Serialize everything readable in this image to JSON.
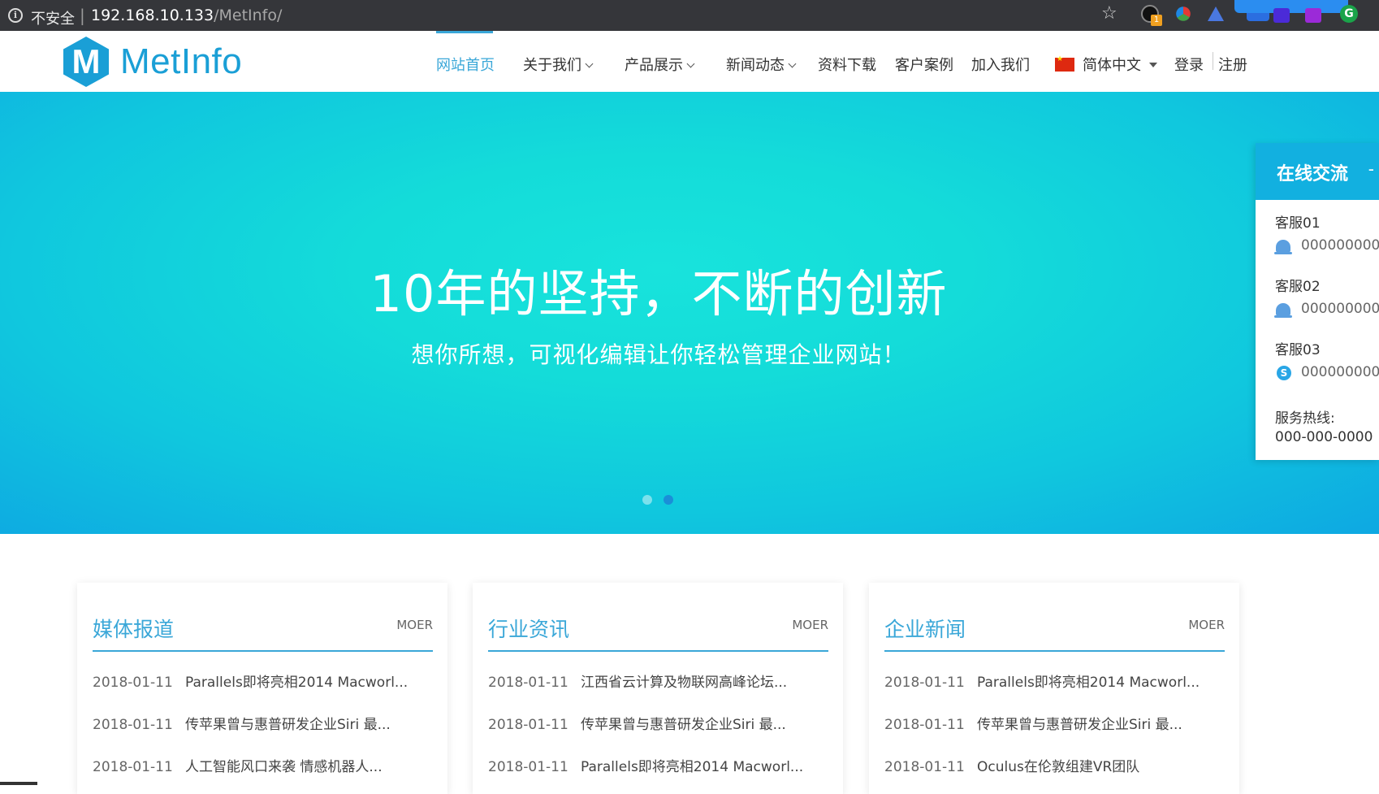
{
  "browser": {
    "security_label": "不安全",
    "separator": "|",
    "url_host": "192.168.10.133",
    "url_path": "/MetInfo/"
  },
  "site": {
    "logo_text": "MetInfo",
    "logo_letter": "M",
    "brand_color": "#1a9fd6",
    "accent_color": "#3aa7d8"
  },
  "nav": {
    "items": [
      {
        "label": "网站首页",
        "active": true
      },
      {
        "label": "关于我们",
        "dropdown": true
      },
      {
        "label": "产品展示",
        "dropdown": true
      },
      {
        "label": "新闻动态",
        "dropdown": true
      },
      {
        "label": "资料下载"
      },
      {
        "label": "客户案例"
      },
      {
        "label": "加入我们"
      }
    ],
    "language": "简体中文",
    "login": "登录",
    "register": "注册"
  },
  "banner": {
    "title": "10年的坚持，不断的创新",
    "subtitle": "想你所想，可视化编辑让你轻松管理企业网站！",
    "slides": 2,
    "active_slide": 2
  },
  "chat": {
    "title": "在线交流",
    "minimize": "-",
    "agents": [
      {
        "name": "客服01",
        "number": "000000000",
        "icon": "qq-icon"
      },
      {
        "name": "客服02",
        "number": "000000000",
        "icon": "qq-icon"
      },
      {
        "name": "客服03",
        "number": "000000000",
        "icon": "skype-icon"
      }
    ],
    "hotline_label": "服务热线:",
    "hotline": "000-000-0000"
  },
  "news": [
    {
      "title": "媒体报道",
      "more": "MOER",
      "items": [
        {
          "date": "2018-01-11",
          "title": "Parallels即将亮相2014 Macworl..."
        },
        {
          "date": "2018-01-11",
          "title": "传苹果曾与惠普研发企业Siri 最..."
        },
        {
          "date": "2018-01-11",
          "title": "人工智能风口来袭 情感机器人..."
        }
      ]
    },
    {
      "title": "行业资讯",
      "more": "MOER",
      "items": [
        {
          "date": "2018-01-11",
          "title": "江西省云计算及物联网高峰论坛..."
        },
        {
          "date": "2018-01-11",
          "title": "传苹果曾与惠普研发企业Siri 最..."
        },
        {
          "date": "2018-01-11",
          "title": "Parallels即将亮相2014 Macworl..."
        }
      ]
    },
    {
      "title": "企业新闻",
      "more": "MOER",
      "items": [
        {
          "date": "2018-01-11",
          "title": "Parallels即将亮相2014 Macworl..."
        },
        {
          "date": "2018-01-11",
          "title": "传苹果曾与惠普研发企业Siri 最..."
        },
        {
          "date": "2018-01-11",
          "title": "Oculus在伦敦组建VR团队"
        }
      ]
    }
  ]
}
